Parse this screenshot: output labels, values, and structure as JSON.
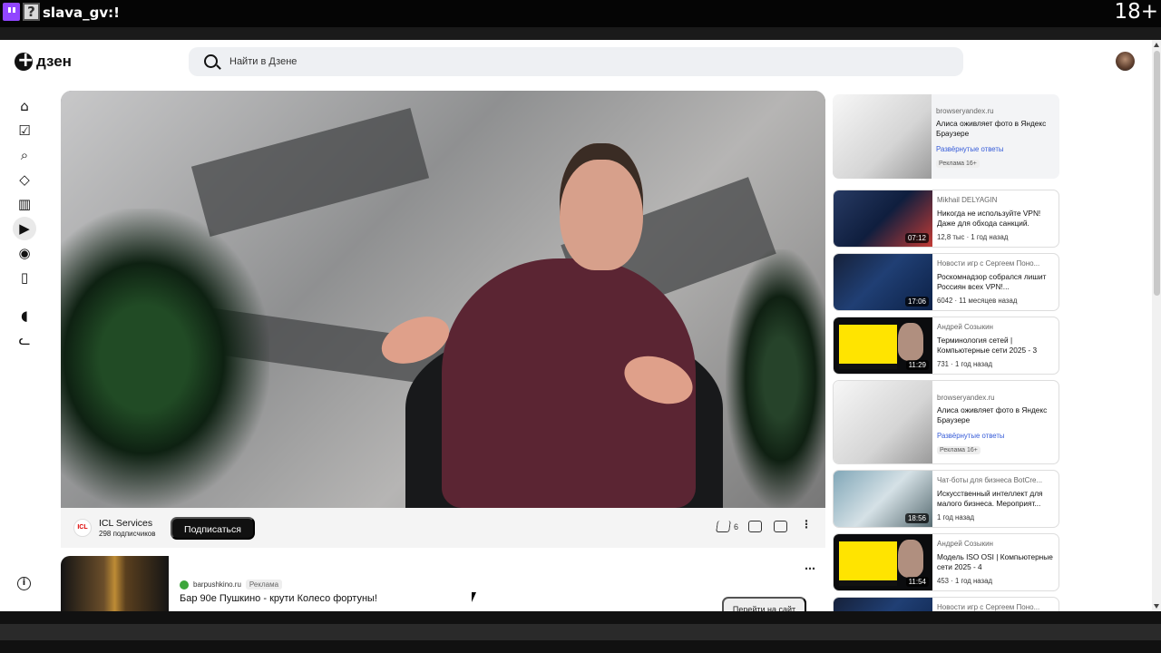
{
  "stream": {
    "username": "slava_gv",
    "message": ":!",
    "age": "18+"
  },
  "app": {
    "logo_text": "дзен",
    "search_placeholder": "Найти в Дзене"
  },
  "nav": [
    "home-icon",
    "check-icon",
    "search-icon",
    "cube-icon",
    "book-icon",
    "play-icon",
    "database-icon",
    "bookmark-icon",
    "gamepad-icon",
    "cat-icon",
    "info-icon"
  ],
  "video": {
    "channel": "ICL Services",
    "subscribers": "298 подписчиков",
    "subscribe_label": "Подписаться",
    "likes": "6"
  },
  "promo": {
    "source": "barpushkino.ru",
    "ad_label": "Реклама",
    "title": "Бар 90е Пушкино - крути Колесо фортуны!",
    "button": "Перейти на сайт"
  },
  "side": [
    {
      "source": "browseryandex.ru",
      "title": "Алиса оживляет фото в Яндекс Браузере",
      "meta": "Развёрнутые ответы",
      "age": "Реклама 16+",
      "ad": true
    },
    {
      "source": "Mikhail DELYAGIN",
      "title": "Никогда не используйте VPN! Даже для обхода санкций.",
      "meta": "12,8 тыс · 1 год назад",
      "duration": "07:12"
    },
    {
      "source": "Новости игр с Сергеем Поно...",
      "title": "Роскомнадзор собрался лишит Россиян всех VPN!...",
      "meta": "6042 · 11 месяцев назад",
      "duration": "17:06"
    },
    {
      "source": "Андрей Созыкин",
      "title": "Терминология сетей | Компьютерные сети 2025 - 3",
      "meta": "731 · 1 год назад",
      "duration": "11:29"
    },
    {
      "source": "browseryandex.ru",
      "title": "Алиса оживляет фото в Яндекс Браузере",
      "meta": "Развёрнутые ответы",
      "age": "Реклама 16+",
      "ad": true
    },
    {
      "source": "Чат-боты для бизнеса BotCre...",
      "title": "Искусственный интеллект для малого бизнеса. Мероприят...",
      "meta": "1 год назад",
      "duration": "18:56"
    },
    {
      "source": "Андрей Созыкин",
      "title": "Модель ISO OSI | Компьютерные сети 2025 - 4",
      "meta": "453 · 1 год назад",
      "duration": "11:54"
    },
    {
      "source": "Новости игр с Сергеем Поно...",
      "title": "",
      "meta": "",
      "duration": ""
    }
  ]
}
